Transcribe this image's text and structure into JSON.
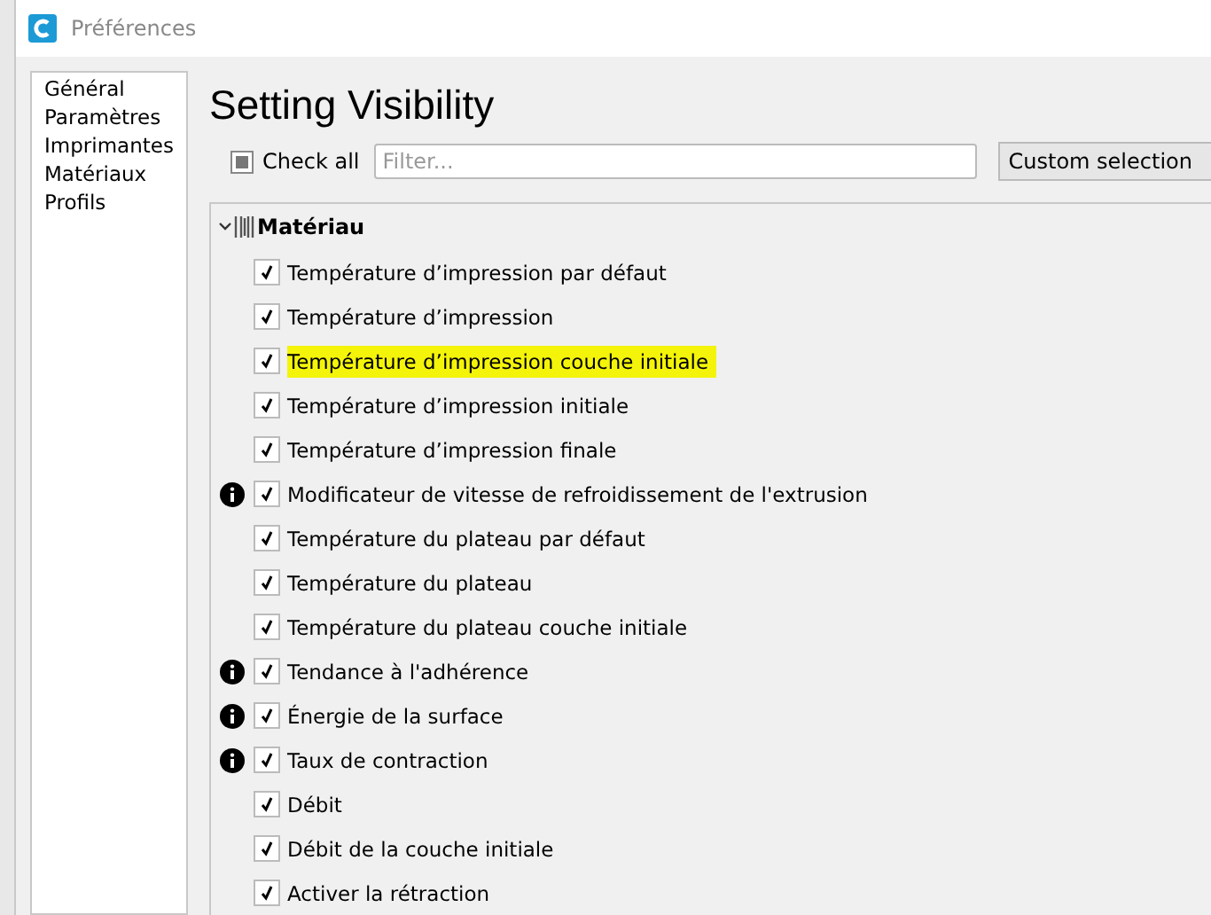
{
  "window": {
    "title": "Préférences"
  },
  "sidebar": {
    "items": [
      {
        "label": "Général",
        "selected": false
      },
      {
        "label": "Paramètres",
        "selected": false
      },
      {
        "label": "Imprimantes",
        "selected": false
      },
      {
        "label": "Matériaux",
        "selected": false
      },
      {
        "label": "Profils",
        "selected": false
      }
    ]
  },
  "page": {
    "title": "Setting Visibility",
    "check_all": {
      "label": "Check all",
      "checked": false
    },
    "filter": {
      "placeholder": "Filter..."
    },
    "preset": {
      "value": "Custom selection"
    }
  },
  "category": {
    "label": "Matériau",
    "expanded": true,
    "settings": [
      {
        "label": "Température d’impression par défaut",
        "checked": true,
        "info": false,
        "highlighted": false
      },
      {
        "label": "Température d’impression",
        "checked": true,
        "info": false,
        "highlighted": false
      },
      {
        "label": "Température d’impression couche initiale",
        "checked": true,
        "info": false,
        "highlighted": true
      },
      {
        "label": "Température d’impression initiale",
        "checked": true,
        "info": false,
        "highlighted": false
      },
      {
        "label": "Température d’impression finale",
        "checked": true,
        "info": false,
        "highlighted": false
      },
      {
        "label": "Modificateur de vitesse de refroidissement de l'extrusion",
        "checked": true,
        "info": true,
        "highlighted": false
      },
      {
        "label": "Température du plateau par défaut",
        "checked": true,
        "info": false,
        "highlighted": false
      },
      {
        "label": "Température du plateau",
        "checked": true,
        "info": false,
        "highlighted": false
      },
      {
        "label": "Température du plateau couche initiale",
        "checked": true,
        "info": false,
        "highlighted": false
      },
      {
        "label": "Tendance à l'adhérence",
        "checked": true,
        "info": true,
        "highlighted": false
      },
      {
        "label": "Énergie de la surface",
        "checked": true,
        "info": true,
        "highlighted": false
      },
      {
        "label": "Taux de contraction",
        "checked": true,
        "info": true,
        "highlighted": false
      },
      {
        "label": "Débit",
        "checked": true,
        "info": false,
        "highlighted": false
      },
      {
        "label": "Débit de la couche initiale",
        "checked": true,
        "info": false,
        "highlighted": false
      },
      {
        "label": "Activer la rétraction",
        "checked": true,
        "info": false,
        "highlighted": false
      }
    ]
  }
}
